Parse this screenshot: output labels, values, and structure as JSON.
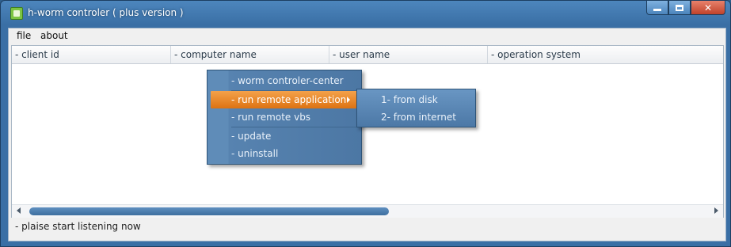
{
  "window": {
    "title": "h-worm controler ( plus version )"
  },
  "menubar": {
    "items": [
      "file",
      "about"
    ]
  },
  "listview": {
    "columns": [
      "- client id",
      "- computer name",
      "- user name",
      "- operation system"
    ]
  },
  "context_menu": {
    "items": [
      "- worm controler-center",
      "- run remote application",
      "- run remote vbs",
      "- update",
      "- uninstall"
    ],
    "highlighted_index": 1
  },
  "submenu": {
    "items": [
      "1- from disk",
      "2- from internet"
    ]
  },
  "statusbar": {
    "text": "- plaise start listening now"
  },
  "icons": {
    "app": "app-icon",
    "minimize": "minimize-icon",
    "maximize": "maximize-icon",
    "close": "close-icon",
    "submenu_arrow": "chevron-right-icon",
    "scroll_left": "arrow-left-icon",
    "scroll_right": "arrow-right-icon"
  },
  "colors": {
    "titlebar": "#3a6fa5",
    "menu_background": "#4c77a4",
    "menu_highlight": "#e88426",
    "close_button": "#c0422a"
  },
  "scrollbar": {
    "horizontal_position_fraction": 0.0,
    "horizontal_visible_fraction": 0.52
  }
}
